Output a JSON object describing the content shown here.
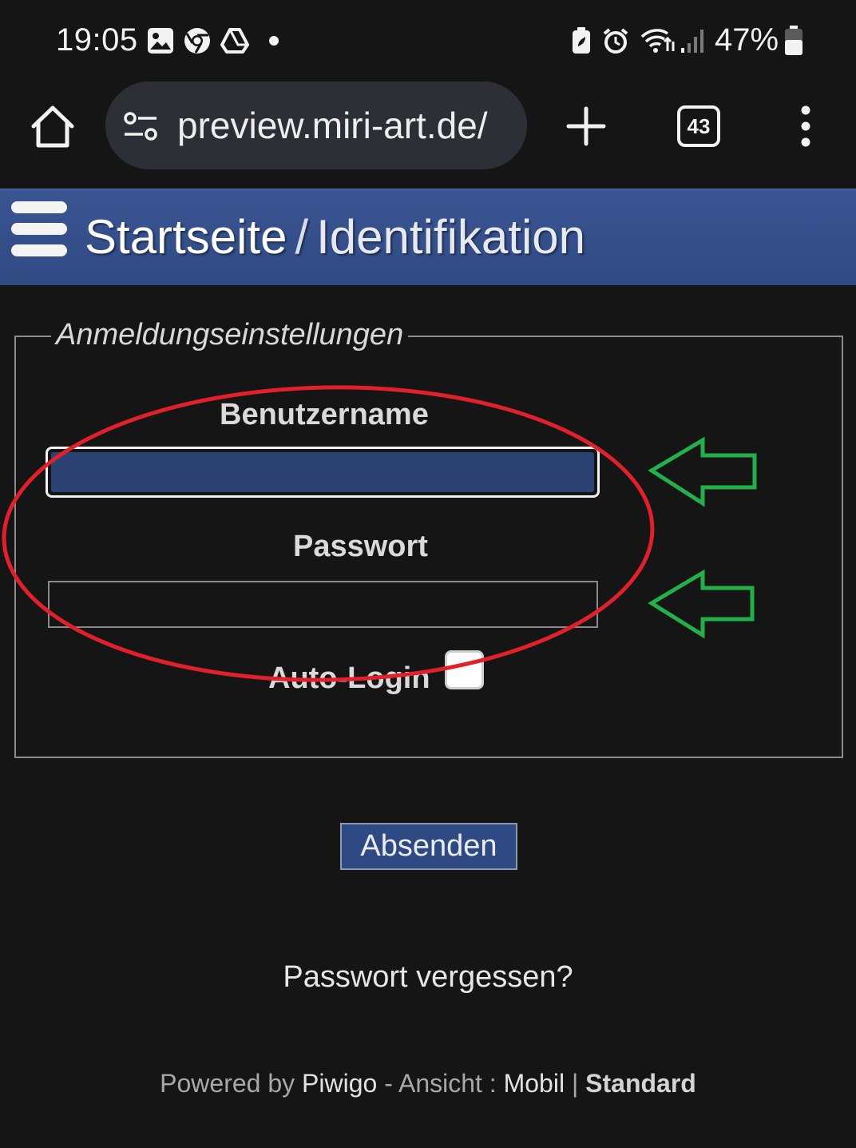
{
  "status_bar": {
    "time": "19:05",
    "battery_percent": "47%",
    "icons": [
      "gallery-icon",
      "chrome-icon",
      "drive-icon",
      "dot-icon",
      "battery-saver-icon",
      "alarm-icon",
      "wifi-icon",
      "signal-icon",
      "battery-icon"
    ]
  },
  "browser": {
    "url": "preview.miri-art.de/",
    "tab_count": "43"
  },
  "header": {
    "home_crumb": "Startseite",
    "separator": "/",
    "current_crumb": "Identifikation"
  },
  "login": {
    "legend": "Anmeldungseinstellungen",
    "username_label": "Benutzername",
    "username_value": "",
    "password_label": "Passwort",
    "password_value": "",
    "autologin_label": "Auto-Login",
    "autologin_checked": false,
    "submit_label": "Absenden",
    "forgot_label": "Passwort vergessen?"
  },
  "footer": {
    "powered_by": "Powered by",
    "piwigo": "Piwigo",
    "view_sep": "- Ansicht :",
    "mobile": "Mobil",
    "pipe": "|",
    "standard": "Standard"
  },
  "colors": {
    "background": "#151515",
    "header_blue": "#34508c",
    "input_fill": "#2c4273",
    "annotation_red": "#e0202a",
    "annotation_green": "#22b04a"
  }
}
